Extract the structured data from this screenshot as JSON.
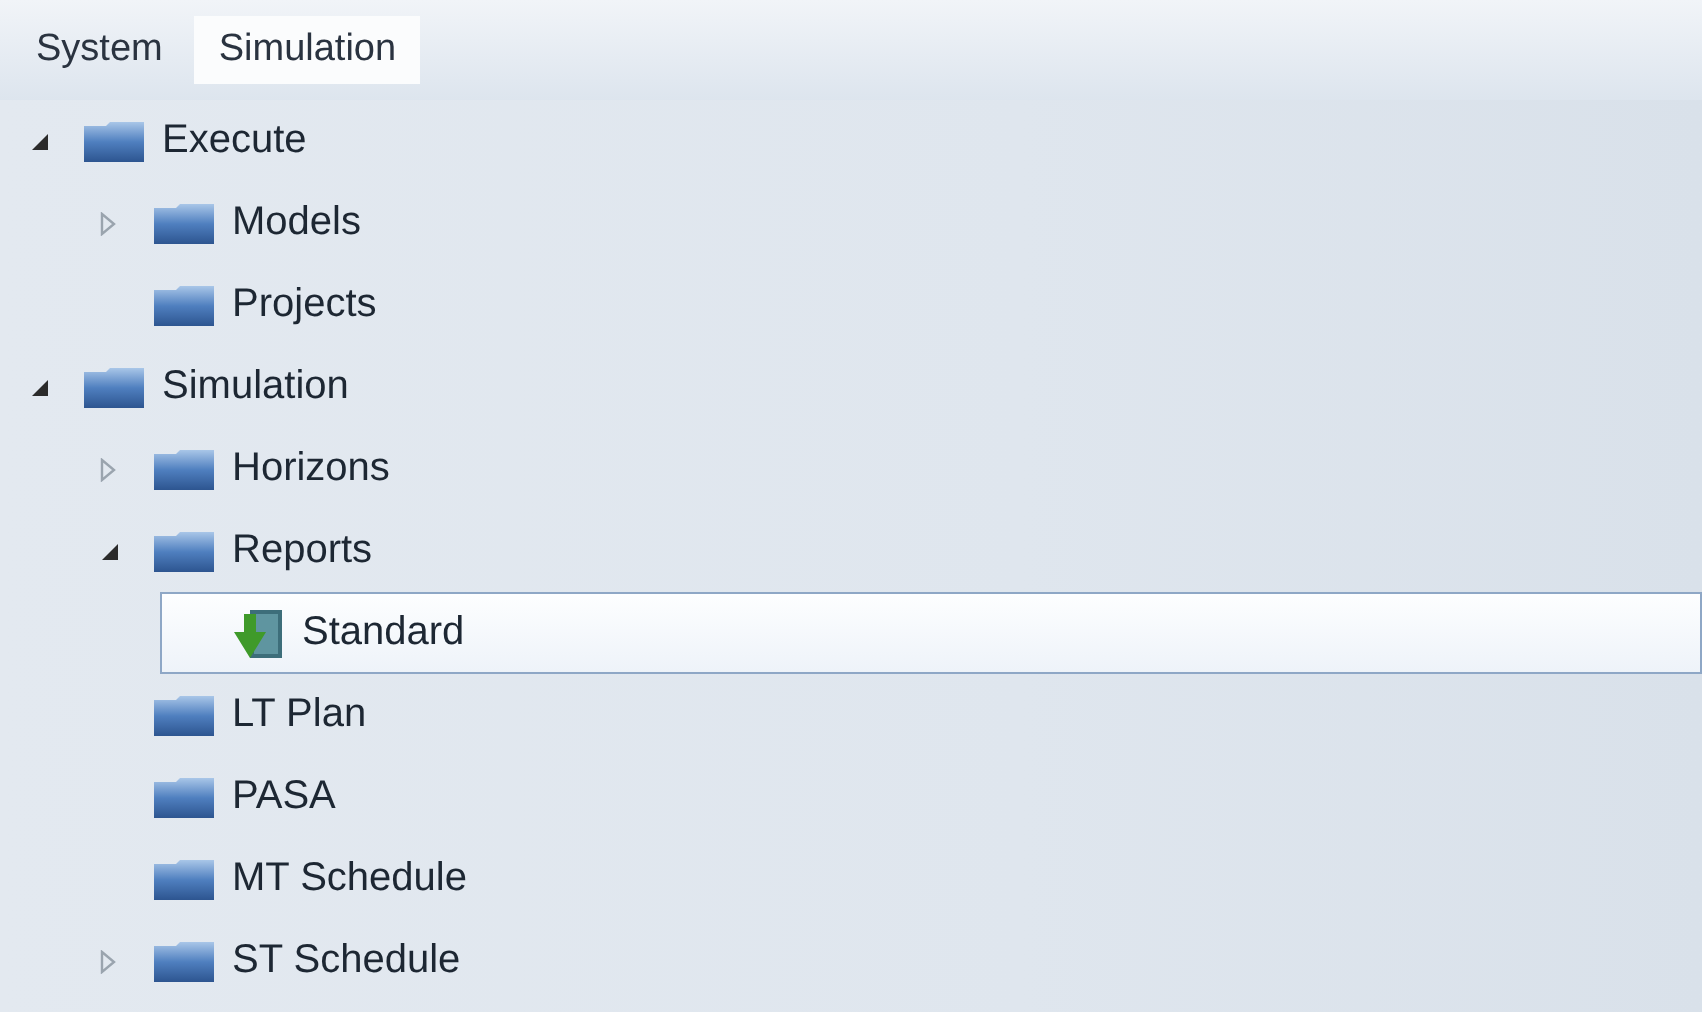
{
  "menu": [
    {
      "label": "System",
      "selected": false
    },
    {
      "label": "Simulation",
      "selected": true
    }
  ],
  "tree": [
    {
      "label": "Execute",
      "kind": "folder",
      "selected": false,
      "expanded": true,
      "children": [
        {
          "label": "Models",
          "kind": "folder",
          "selected": false,
          "expanded": false
        },
        {
          "label": "Projects",
          "kind": "folder",
          "selected": false
        }
      ]
    },
    {
      "label": "Simulation",
      "kind": "folder",
      "selected": false,
      "expanded": true,
      "children": [
        {
          "label": "Horizons",
          "kind": "folder",
          "selected": false,
          "expanded": false
        },
        {
          "label": "Reports",
          "kind": "folder",
          "selected": false,
          "expanded": true,
          "children": [
            {
              "label": "Standard",
              "kind": "report",
              "selected": true
            }
          ]
        },
        {
          "label": "LT Plan",
          "kind": "folder",
          "selected": false
        },
        {
          "label": "PASA",
          "kind": "folder",
          "selected": false
        },
        {
          "label": "MT Schedule",
          "kind": "folder",
          "selected": false
        },
        {
          "label": "ST Schedule",
          "kind": "folder",
          "selected": false,
          "expanded": false
        }
      ]
    }
  ]
}
